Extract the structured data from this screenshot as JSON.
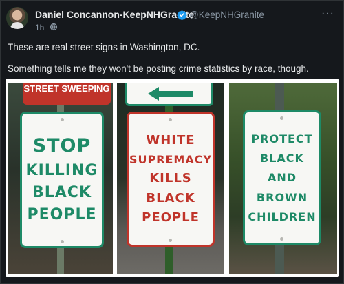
{
  "post": {
    "author_name": "Daniel Concannon-KeepNHGranite",
    "handle": "@KeepNHGranite",
    "time": "1h",
    "more_label": "···",
    "text_line1": "These are real street signs in Washington, DC.",
    "text_line2": "Something tells me they won't be posting crime statistics by race, though."
  },
  "media": {
    "photos": [
      {
        "top_sign": [
          "STREET",
          "SWEEPING"
        ],
        "sign_lines": [
          "STOP",
          "KILLING",
          "BLACK",
          "PEOPLE"
        ],
        "sign_color": "#1e8a67"
      },
      {
        "top_sign_icon": "left-arrow-icon",
        "sign_lines": [
          "WHITE",
          "SUPREMACY",
          "KILLS",
          "BLACK",
          "PEOPLE"
        ],
        "sign_color": "#c0342a"
      },
      {
        "sign_lines": [
          "PROTECT",
          "BLACK",
          "AND",
          "BROWN",
          "CHILDREN"
        ],
        "sign_color": "#1e8a67"
      }
    ]
  },
  "colors": {
    "background": "#15181c",
    "text": "#e7e9ea",
    "muted": "#8b98a5",
    "verified": "#1d9bf0"
  }
}
